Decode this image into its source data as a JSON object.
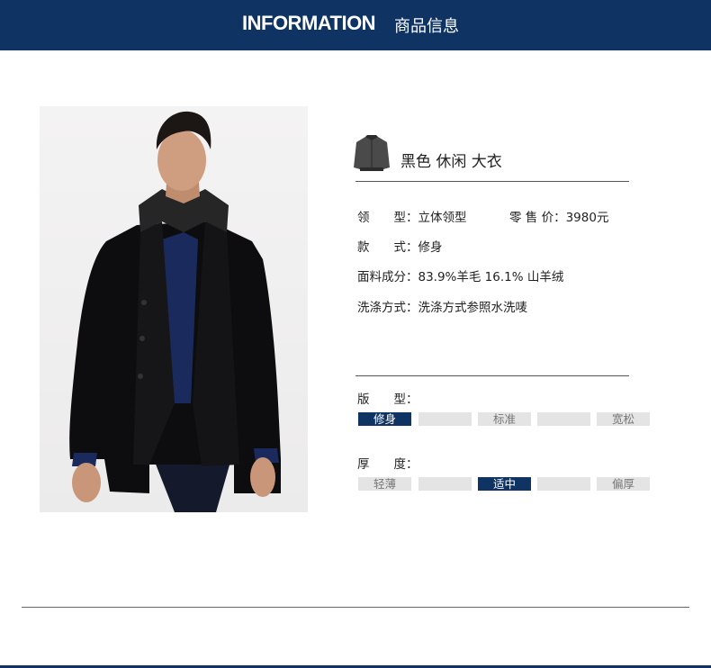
{
  "header": {
    "title_en": "INFORMATION",
    "title_cn": "商品信息"
  },
  "product": {
    "name": "黑色 休闲 大衣",
    "photo_icon": "model-photo",
    "thumb_icon": "jacket-thumbnail-icon"
  },
  "specs": {
    "collar_label": "领　　型：",
    "collar_value": "立体领型",
    "price_label": "零 售 价：",
    "price_value": "3980元",
    "style_label": "款　　式：",
    "style_value": "修身",
    "fabric_label": "面料成分：",
    "fabric_value": "83.9%羊毛 16.1% 山羊绒",
    "wash_label": "洗涤方式：",
    "wash_value": "洗涤方式参照水洗唛"
  },
  "fit_scale": {
    "label": "版　　型：",
    "options": [
      "修身",
      "",
      "标准",
      "",
      "宽松"
    ],
    "selected": "修身"
  },
  "thickness_scale": {
    "label": "厚　　度：",
    "options": [
      "轻薄",
      "",
      "适中",
      "",
      "偏厚"
    ],
    "selected": "适中"
  },
  "colors": {
    "navy": "#0f3464",
    "scale_bg": "#e4e4e4"
  }
}
